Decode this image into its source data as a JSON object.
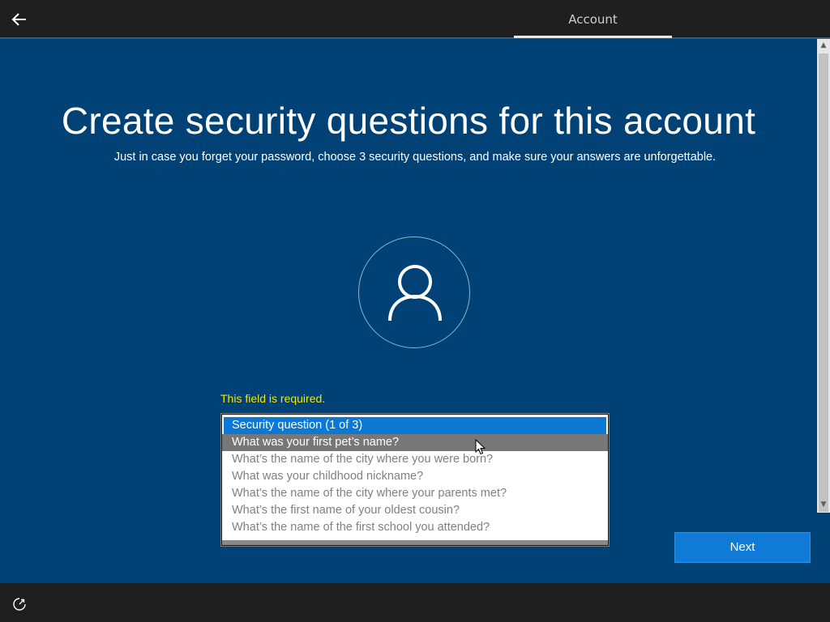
{
  "header": {
    "tab_label": "Account"
  },
  "main": {
    "title": "Create security questions for this account",
    "subtitle": "Just in case you forget your password, choose 3 security questions, and make sure your answers are unforgettable.",
    "error_text": "This field is required."
  },
  "listbox": {
    "options": [
      "Security question (1 of 3)",
      "What was your first pet’s name?",
      "What’s the name of the city where you were born?",
      "What was your childhood nickname?",
      "What’s the name of the city where your parents met?",
      "What’s the first name of your oldest cousin?",
      "What’s the name of the first school you attended?"
    ]
  },
  "buttons": {
    "next_label": "Next"
  },
  "colors": {
    "background": "#004275",
    "accent": "#0b78d3",
    "error": "#f2e600",
    "bar": "#1f1f1f"
  },
  "icons": {
    "back": "back-arrow-icon",
    "avatar": "user-icon",
    "ease_of_access": "ease-of-access-icon"
  }
}
